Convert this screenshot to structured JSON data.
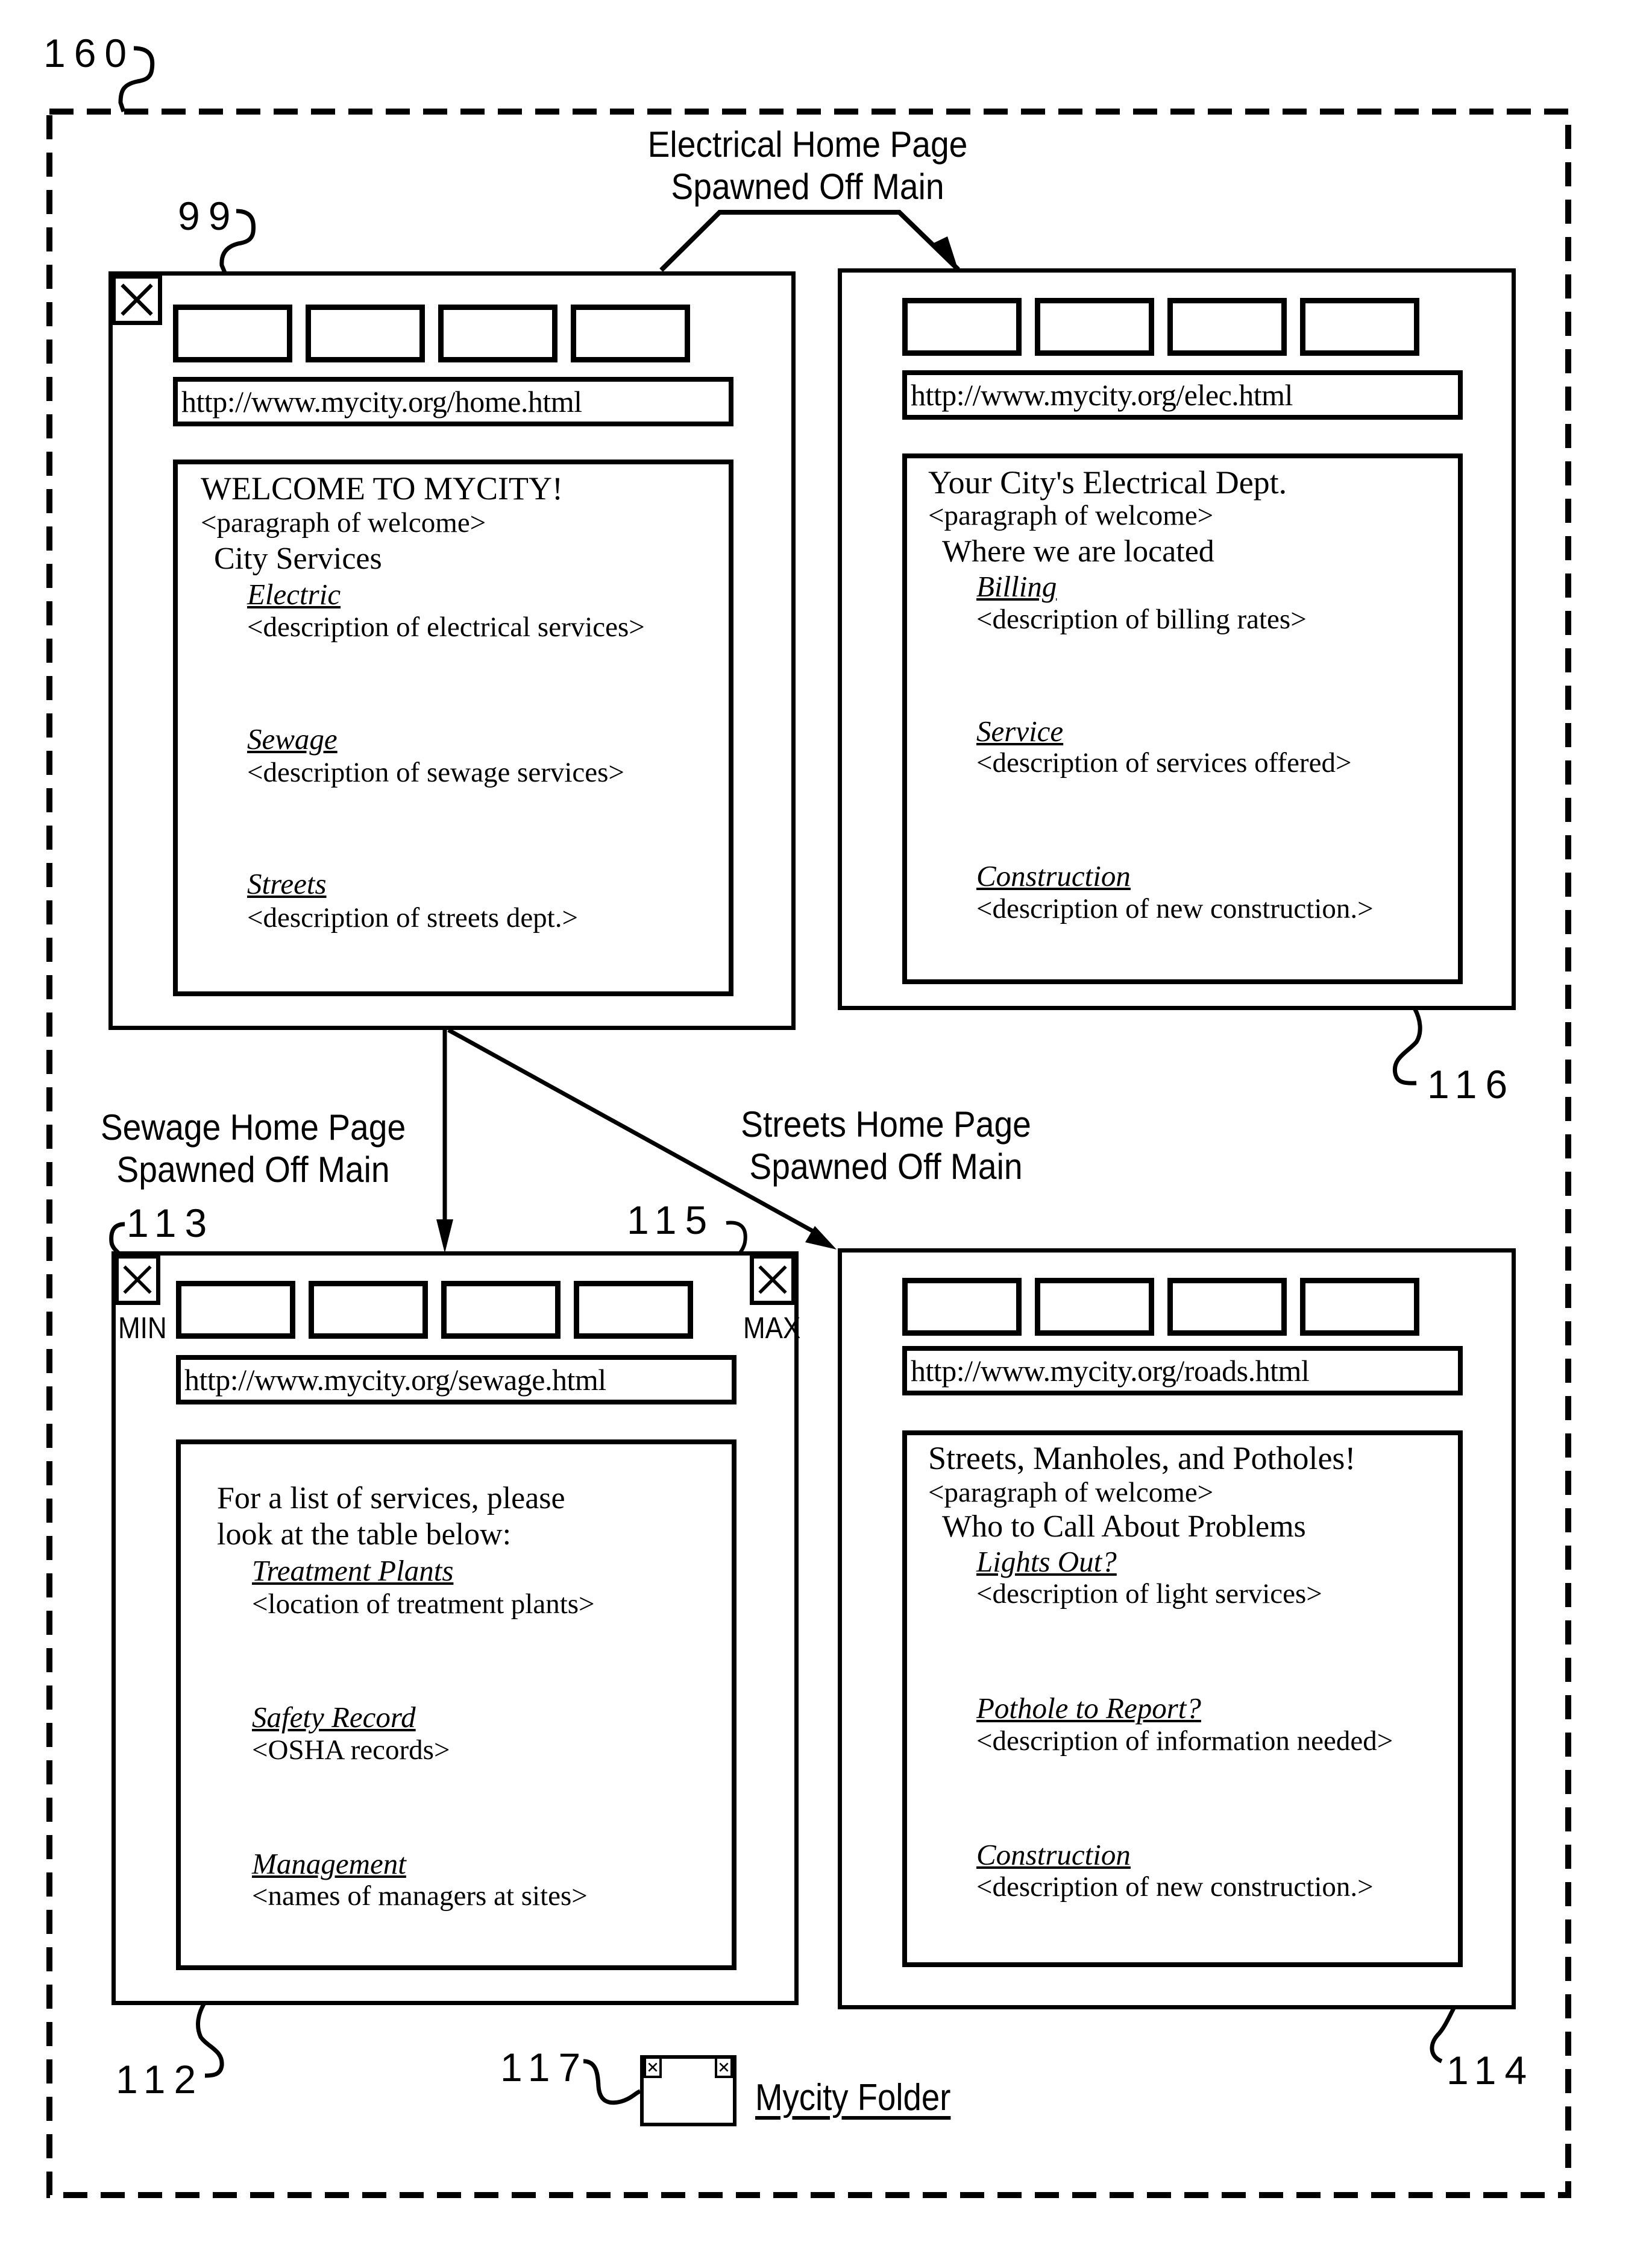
{
  "figure": {
    "reference_numerals": {
      "desktop": "160",
      "main_window": "99",
      "electric_window": "116",
      "sewage_window": "112",
      "streets_window": "114",
      "min_button": "113",
      "max_button": "115",
      "folder": "117"
    },
    "captions": {
      "electrical": [
        "Electrical Home Page",
        "Spawned Off Main"
      ],
      "sewage": [
        "Sewage Home Page",
        "Spawned Off Main"
      ],
      "streets": [
        "Streets Home Page",
        "Spawned Off Main"
      ]
    },
    "folder_label": "Mycity Folder"
  },
  "windows": {
    "main": {
      "url": "http://www.mycity.org/home.html",
      "heading": "WELCOME TO MYCITY!",
      "paragraph": "<paragraph of welcome>",
      "subheading": "City Services",
      "links": [
        {
          "label": "Electric",
          "description": "<description of electrical services>"
        },
        {
          "label": "Sewage",
          "description": "<description of sewage services>"
        },
        {
          "label": "Streets",
          "description": "<description of streets dept.>"
        }
      ],
      "close_icon": "x-icon"
    },
    "electric": {
      "url": "http://www.mycity.org/elec.html",
      "heading": "Your City's Electrical Dept.",
      "paragraph": "<paragraph of welcome>",
      "subheading": "Where we are located",
      "links": [
        {
          "label": "Billing",
          "description": "<description of billing rates>"
        },
        {
          "label": "Service",
          "description": "<description of services offered>"
        },
        {
          "label": "Construction",
          "description": "<description of new construction.>"
        }
      ]
    },
    "sewage": {
      "url": "http://www.mycity.org/sewage.html",
      "intro": [
        "For a list of services, please",
        "look at the table below:"
      ],
      "links": [
        {
          "label": "Treatment Plants",
          "description": "<location of treatment plants>"
        },
        {
          "label": "Safety Record",
          "description": "<OSHA records>"
        },
        {
          "label": "Management",
          "description": "<names of managers at sites>"
        }
      ],
      "min_label": "MIN",
      "max_label": "MAX"
    },
    "streets": {
      "url": "http://www.mycity.org/roads.html",
      "heading": "Streets, Manholes, and Potholes!",
      "paragraph": "<paragraph of welcome>",
      "subheading": "Who to Call About Problems",
      "links": [
        {
          "label": "Lights Out?",
          "description": "<description of light services>"
        },
        {
          "label": "Pothole to Report?",
          "description": "<description of information needed>"
        },
        {
          "label": "Construction",
          "description": "<description of new construction.>"
        }
      ]
    }
  }
}
